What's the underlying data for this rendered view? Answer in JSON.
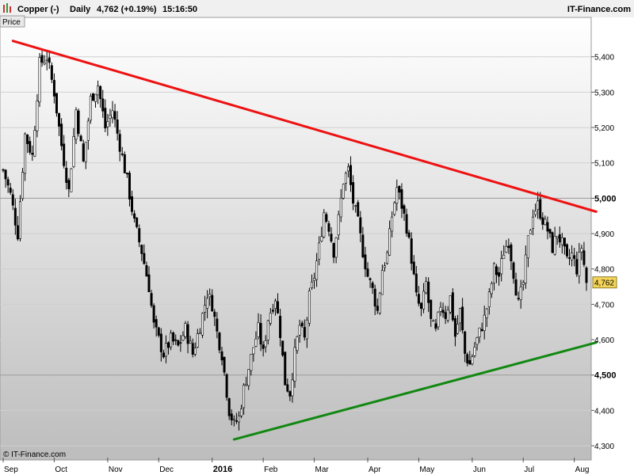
{
  "header": {
    "instrument": "Copper (-)",
    "period": "Daily",
    "quote": "4,762 (+0.19%)",
    "time": "15:16:50",
    "brand": "IT-Finance.com",
    "price_tab": "Price",
    "watermark": "© IT-Finance.com"
  },
  "colors": {
    "resistance": "#ee1111",
    "support": "#118811",
    "candle": "#000000",
    "current_price_bg": "#f5d65a"
  },
  "chart_data": {
    "type": "candlestick",
    "title": "Copper (-) Daily",
    "ylim": [
      4280,
      5480
    ],
    "y_ticks": [
      {
        "value": 5400,
        "label": "5,400"
      },
      {
        "value": 5300,
        "label": "5,300"
      },
      {
        "value": 5200,
        "label": "5,200"
      },
      {
        "value": 5100,
        "label": "5,100"
      },
      {
        "value": 5000,
        "label": "5,000",
        "bold": true
      },
      {
        "value": 4900,
        "label": "4,900"
      },
      {
        "value": 4800,
        "label": "4,800"
      },
      {
        "value": 4700,
        "label": "4,700"
      },
      {
        "value": 4600,
        "label": "4,600"
      },
      {
        "value": 4500,
        "label": "4,500",
        "bold": true
      },
      {
        "value": 4400,
        "label": "4,400"
      },
      {
        "value": 4300,
        "label": "4,300"
      }
    ],
    "x_ticks": [
      {
        "index": 0,
        "label": "Sep"
      },
      {
        "index": 21,
        "label": "Oct"
      },
      {
        "index": 43,
        "label": "Nov"
      },
      {
        "index": 64,
        "label": "Dec"
      },
      {
        "index": 86,
        "label": "2016",
        "bold": true
      },
      {
        "index": 107,
        "label": "Feb"
      },
      {
        "index": 128,
        "label": "Mar"
      },
      {
        "index": 150,
        "label": "Apr"
      },
      {
        "index": 171,
        "label": "May"
      },
      {
        "index": 193,
        "label": "Jun"
      },
      {
        "index": 214,
        "label": "Jul"
      },
      {
        "index": 235,
        "label": "Aug"
      }
    ],
    "current_price": {
      "value": 4762,
      "label": "4,762"
    },
    "closes_path": [
      [
        0,
        5080
      ],
      [
        3,
        5010
      ],
      [
        6,
        4900
      ],
      [
        9,
        5180
      ],
      [
        12,
        5120
      ],
      [
        15,
        5380
      ],
      [
        18,
        5400
      ],
      [
        21,
        5300
      ],
      [
        24,
        5150
      ],
      [
        27,
        5020
      ],
      [
        30,
        5250
      ],
      [
        33,
        5100
      ],
      [
        36,
        5280
      ],
      [
        39,
        5320
      ],
      [
        42,
        5200
      ],
      [
        45,
        5250
      ],
      [
        48,
        5150
      ],
      [
        51,
        5050
      ],
      [
        54,
        4930
      ],
      [
        57,
        4850
      ],
      [
        60,
        4750
      ],
      [
        62,
        4640
      ],
      [
        64,
        4600
      ],
      [
        66,
        4560
      ],
      [
        69,
        4600
      ],
      [
        72,
        4580
      ],
      [
        75,
        4630
      ],
      [
        78,
        4560
      ],
      [
        81,
        4640
      ],
      [
        84,
        4730
      ],
      [
        86,
        4700
      ],
      [
        88,
        4620
      ],
      [
        90,
        4560
      ],
      [
        93,
        4400
      ],
      [
        95,
        4360
      ],
      [
        97,
        4380
      ],
      [
        99,
        4460
      ],
      [
        101,
        4520
      ],
      [
        103,
        4580
      ],
      [
        105,
        4630
      ],
      [
        107,
        4560
      ],
      [
        109,
        4660
      ],
      [
        112,
        4720
      ],
      [
        114,
        4620
      ],
      [
        116,
        4480
      ],
      [
        118,
        4450
      ],
      [
        120,
        4560
      ],
      [
        122,
        4640
      ],
      [
        124,
        4600
      ],
      [
        126,
        4720
      ],
      [
        128,
        4780
      ],
      [
        130,
        4860
      ],
      [
        132,
        4960
      ],
      [
        134,
        4920
      ],
      [
        136,
        4850
      ],
      [
        138,
        4940
      ],
      [
        140,
        5050
      ],
      [
        142,
        5080
      ],
      [
        144,
        4990
      ],
      [
        146,
        4930
      ],
      [
        148,
        4850
      ],
      [
        150,
        4780
      ],
      [
        152,
        4740
      ],
      [
        154,
        4680
      ],
      [
        156,
        4800
      ],
      [
        158,
        4840
      ],
      [
        160,
        4950
      ],
      [
        162,
        5030
      ],
      [
        164,
        4980
      ],
      [
        166,
        4920
      ],
      [
        168,
        4830
      ],
      [
        170,
        4720
      ],
      [
        172,
        4680
      ],
      [
        174,
        4760
      ],
      [
        176,
        4650
      ],
      [
        178,
        4620
      ],
      [
        180,
        4700
      ],
      [
        182,
        4670
      ],
      [
        184,
        4720
      ],
      [
        186,
        4610
      ],
      [
        188,
        4680
      ],
      [
        190,
        4560
      ],
      [
        192,
        4530
      ],
      [
        194,
        4580
      ],
      [
        196,
        4620
      ],
      [
        198,
        4660
      ],
      [
        200,
        4720
      ],
      [
        202,
        4800
      ],
      [
        204,
        4780
      ],
      [
        206,
        4850
      ],
      [
        208,
        4880
      ],
      [
        210,
        4790
      ],
      [
        212,
        4700
      ],
      [
        214,
        4760
      ],
      [
        216,
        4880
      ],
      [
        218,
        4960
      ],
      [
        220,
        4980
      ],
      [
        222,
        4940
      ],
      [
        224,
        4910
      ],
      [
        226,
        4860
      ],
      [
        228,
        4900
      ],
      [
        230,
        4870
      ],
      [
        232,
        4820
      ],
      [
        234,
        4840
      ],
      [
        236,
        4800
      ],
      [
        238,
        4862
      ],
      [
        240,
        4762
      ]
    ],
    "trendlines": [
      {
        "name": "resistance",
        "start": [
          4,
          5445
        ],
        "end": [
          244,
          4962
        ]
      },
      {
        "name": "support",
        "start": [
          95,
          4318
        ],
        "end": [
          244,
          4592
        ]
      }
    ],
    "n_bars": 241,
    "grid": true
  }
}
